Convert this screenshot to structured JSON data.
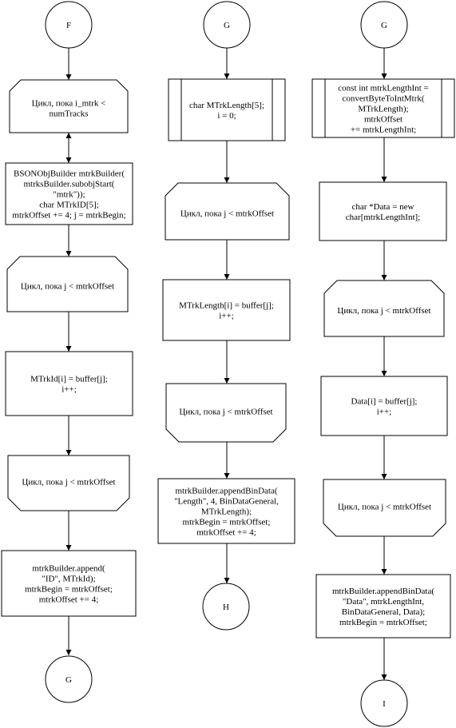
{
  "flowchart": {
    "col1": {
      "start": "F",
      "loop_start": [
        "Цикл, пока i_mtrk <",
        "numTracks"
      ],
      "builder": [
        "BSONObjBuilder mtrkBuilder(",
        "mtrksBuilder.subobjStart(",
        "\"mtrk\"));",
        "char MTrkID[5];",
        "mtrkOffset += 4; j = mtrkBegin;"
      ],
      "loop_j_start": [
        "Цикл, пока j < mtrkOffset"
      ],
      "assign": [
        "MTrkId[i] = buffer[j];",
        "i++;"
      ],
      "loop_j_end": [
        "Цикл, пока  j < mtrkOffset"
      ],
      "append": [
        "mtrkBuilder.append(",
        "\"ID\", MTrkId);",
        "mtrkBegin = mtrkOffset;",
        "mtrkOffset += 4;"
      ],
      "end": "G"
    },
    "col2": {
      "start": "G",
      "decl": [
        "char MTrkLength[5];",
        "i = 0;"
      ],
      "loop_j_start": [
        "Цикл, пока j < mtrkOffset"
      ],
      "assign": [
        "MTrkLength[i] = buffer[j];",
        "i++;"
      ],
      "loop_j_end": [
        "Цикл, пока  j < mtrkOffset"
      ],
      "append": [
        "mtrkBuilder.appendBinData(",
        "\"Length\", 4, BinDataGeneral,",
        "MTrkLength);",
        "mtrkBegin = mtrkOffset;",
        "mtrkOffset += 4;"
      ],
      "end": "H"
    },
    "col3": {
      "start": "G",
      "convert": [
        "const int mtrkLengthInt =",
        "convertByteToIntMtrk(",
        "MTrkLength);",
        "mtrkOffset",
        "+= mtrkLengthInt;"
      ],
      "alloc": [
        "char *Data = new",
        "char[mtrkLengthInt];"
      ],
      "loop_j_start": [
        "Цикл, пока j < mtrkOffset"
      ],
      "assign": [
        "Data[i] = buffer[j];",
        "i++;"
      ],
      "loop_j_end": [
        "Цикл, пока  j < mtrkOffset"
      ],
      "append": [
        "mtrkBuilder.appendBinData(",
        "\"Data\", mtrkLengthInt,",
        "BinDataGeneral, Data);",
        "mtrkBegin = mtrkOffset;"
      ],
      "end": "I"
    }
  }
}
